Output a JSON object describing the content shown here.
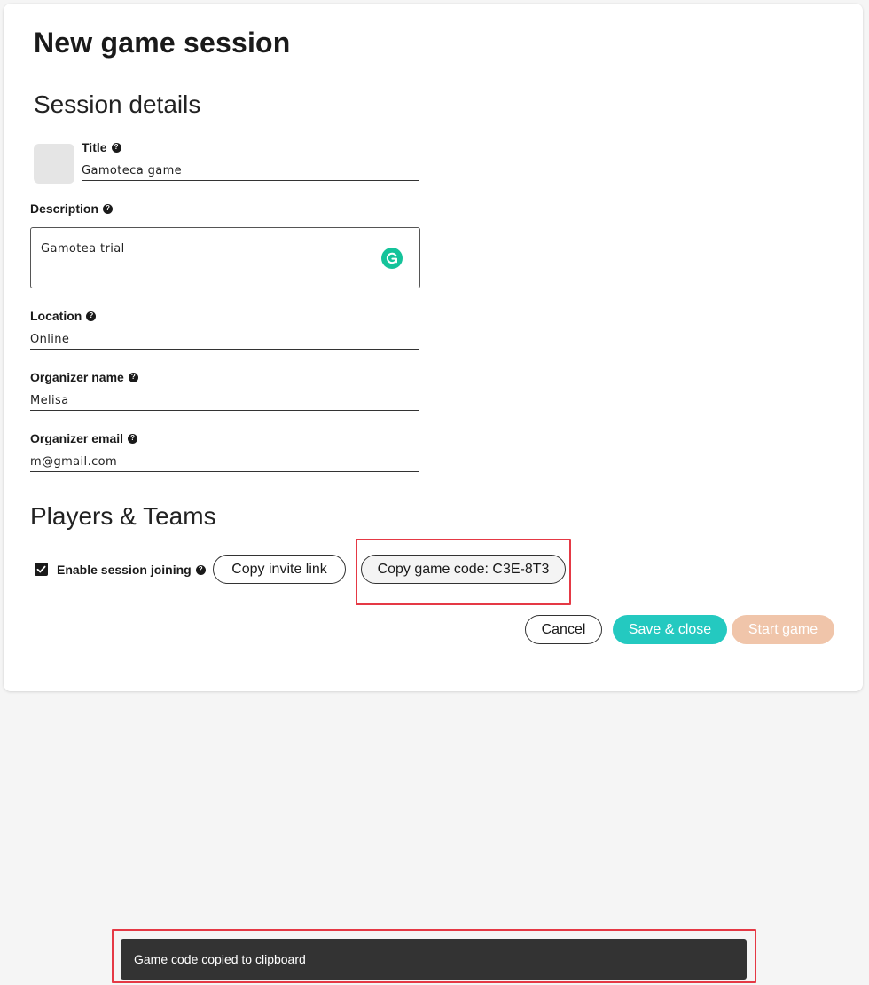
{
  "page": {
    "title": "New game session"
  },
  "session_details": {
    "heading": "Session details",
    "title_label": "Title",
    "title_value": "Gamoteca game",
    "description_label": "Description",
    "description_value": "Gamotea trial",
    "location_label": "Location",
    "location_value": "Online",
    "organizer_name_label": "Organizer name",
    "organizer_name_value": "Melisa",
    "organizer_email_label": "Organizer email",
    "organizer_email_value": "m@gmail.com"
  },
  "players_teams": {
    "heading": "Players & Teams",
    "enable_joining_label": "Enable session joining",
    "enable_joining_checked": true,
    "copy_invite_label": "Copy invite link",
    "copy_code_label": "Copy game code: C3E-8T3"
  },
  "actions": {
    "cancel_label": "Cancel",
    "save_label": "Save & close",
    "start_label": "Start game"
  },
  "snackbar": {
    "message": "Game code copied to clipboard"
  },
  "colors": {
    "accent_teal": "#24c9c0",
    "start_disabled": "#f0c5aa",
    "highlight_red": "#e53945",
    "grammarly_green": "#15c39a"
  },
  "icons": {
    "help": "question-circle-icon",
    "grammarly": "grammarly-icon",
    "checkbox": "checkmark-icon"
  }
}
